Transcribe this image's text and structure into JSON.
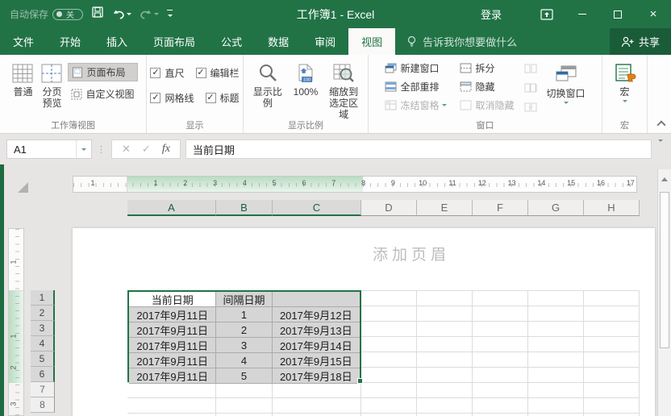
{
  "titlebar": {
    "autosave_label": "自动保存",
    "autosave_state": "关",
    "title": "工作簿1 - Excel",
    "signin_label": "登录"
  },
  "tabs": {
    "labels": [
      "文件",
      "开始",
      "插入",
      "页面布局",
      "公式",
      "数据",
      "审阅",
      "视图"
    ],
    "active": "视图",
    "tellme": "告诉我你想要做什么",
    "share_label": "共享"
  },
  "ribbon": {
    "views": {
      "label": "工作簿视图",
      "normal": "普通",
      "page_break_l1": "分页",
      "page_break_l2": "预览",
      "page_layout": "页面布局",
      "custom": "自定义视图"
    },
    "show": {
      "label": "显示",
      "ruler": "直尺",
      "formula_bar": "编辑栏",
      "gridlines": "网格线",
      "headings": "标题"
    },
    "zoom": {
      "label": "显示比例",
      "zoom": "显示比例",
      "hundred": "100%",
      "selection_l1": "缩放到",
      "selection_l2": "选定区域"
    },
    "window": {
      "label": "窗口",
      "new_window": "新建窗口",
      "arrange_all": "全部重排",
      "freeze": "冻结窗格",
      "split": "拆分",
      "hide": "隐藏",
      "unhide": "取消隐藏",
      "switch": "切换窗口"
    },
    "macros": {
      "label": "宏",
      "button": "宏"
    }
  },
  "formula_bar": {
    "name_box": "A1",
    "value": "当前日期"
  },
  "sheet": {
    "watermark": "添加页眉",
    "column_labels": [
      "A",
      "B",
      "C",
      "D",
      "E",
      "F",
      "G",
      "H"
    ],
    "selected_columns": [
      "A",
      "B",
      "C"
    ],
    "row_labels": [
      "1",
      "2",
      "3",
      "4",
      "5",
      "6",
      "7",
      "8"
    ],
    "selected_rows": [
      "1",
      "2",
      "3",
      "4",
      "5",
      "6"
    ],
    "active_cell": "A1",
    "hruler_margin": "1",
    "hruler_numbers": [
      "1",
      "2",
      "3",
      "4",
      "5",
      "6",
      "7",
      "8",
      "9",
      "10",
      "11",
      "12",
      "13",
      "14",
      "15",
      "16",
      "17"
    ],
    "vruler_margin": "1",
    "vruler_numbers": [
      "1",
      "2",
      "3"
    ],
    "table": {
      "header": [
        "当前日期",
        "间隔日期",
        ""
      ],
      "rows": [
        [
          "2017年9月11日",
          "1",
          "2017年9月12日"
        ],
        [
          "2017年9月11日",
          "2",
          "2017年9月13日"
        ],
        [
          "2017年9月11日",
          "3",
          "2017年9月14日"
        ],
        [
          "2017年9月11日",
          "4",
          "2017年9月15日"
        ],
        [
          "2017年9月11日",
          "5",
          "2017年9月18日"
        ]
      ]
    }
  },
  "colors": {
    "accent": "#217346",
    "selection_fill": "#d5d5d5",
    "grid_line": "#dcdcdc"
  }
}
